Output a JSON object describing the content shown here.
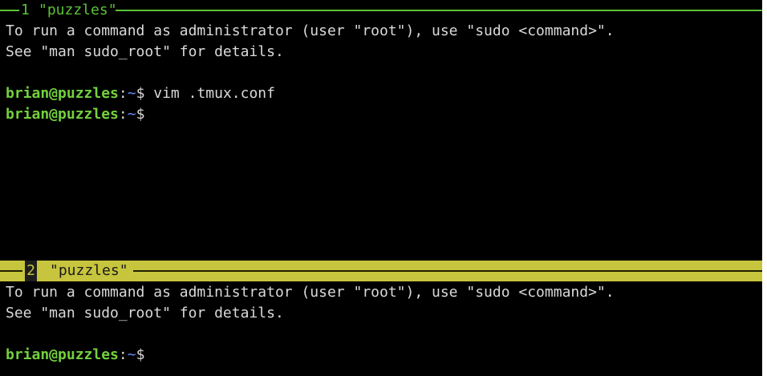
{
  "colors": {
    "background": "#000000",
    "text": "#d9d9d9",
    "active_border": "#c7c43d",
    "inactive_border": "#5bc236",
    "prompt_user": "#73d13d",
    "prompt_path": "#6b8cff"
  },
  "panes": [
    {
      "index": "1",
      "title": "\"puzzles\"",
      "lines": [
        "To run a command as administrator (user \"root\"), use \"sudo <command>\".",
        "See \"man sudo_root\" for details."
      ],
      "prompts": [
        {
          "user_host": "brian@puzzles",
          "colon": ":",
          "path": "~",
          "symbol": "$",
          "command": " vim .tmux.conf"
        },
        {
          "user_host": "brian@puzzles",
          "colon": ":",
          "path": "~",
          "symbol": "$",
          "command": ""
        }
      ]
    },
    {
      "index": "2",
      "title": "\"puzzles\"",
      "lines": [
        "To run a command as administrator (user \"root\"), use \"sudo <command>\".",
        "See \"man sudo_root\" for details."
      ],
      "prompts": [
        {
          "user_host": "brian@puzzles",
          "colon": ":",
          "path": "~",
          "symbol": "$",
          "command": ""
        }
      ]
    }
  ]
}
